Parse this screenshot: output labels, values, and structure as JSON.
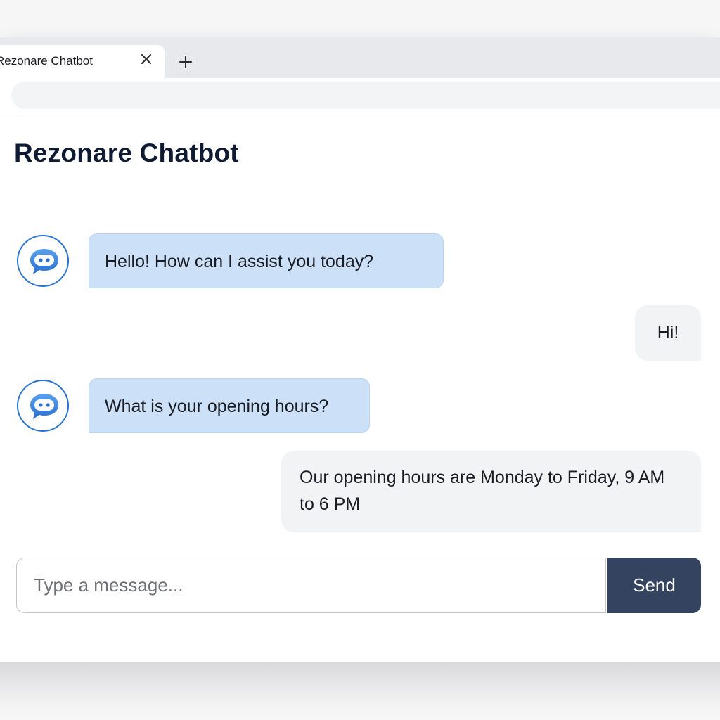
{
  "browser": {
    "tab_title": "Rezonare Chatbot",
    "close_icon": "close-icon",
    "new_tab_icon": "plus-icon",
    "address": ""
  },
  "page": {
    "title": "Rezonare Chatbot"
  },
  "messages": [
    {
      "sender": "bot",
      "text": "Hello! How can I assist you today?"
    },
    {
      "sender": "user",
      "text": "Hi!"
    },
    {
      "sender": "bot",
      "text": "What is your opening hours?"
    },
    {
      "sender": "user",
      "text": "Our opening hours are Monday to Friday, 9 AM to 6 PM"
    }
  ],
  "composer": {
    "placeholder": "Type a message...",
    "value": "",
    "send_label": "Send"
  },
  "colors": {
    "bot_bubble": "#cce0f7",
    "user_bubble": "#f2f3f5",
    "send_button": "#34435f",
    "title": "#0f1a33",
    "avatar_ring": "#2a73d2"
  },
  "icons": {
    "bot_avatar": "chat-bubble-icon"
  }
}
